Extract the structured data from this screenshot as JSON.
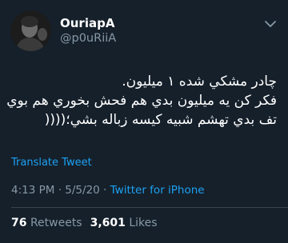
{
  "user": {
    "display_name": "OuriapA",
    "handle": "@p0uRiiA"
  },
  "tweet": {
    "lines": [
      "چادر مشکي شده ۱ ميليون.",
      "فکر کن يه ميليون بدي هم فحش بخوري هم بوي",
      "تف بدي تهشم شبيه کيسه زباله بشي؛(((("
    ],
    "translate_label": "Translate Tweet",
    "time": "4:13 PM",
    "date": "5/5/20",
    "separator": "·",
    "source": "Twitter for iPhone"
  },
  "stats": {
    "retweets_count": "76",
    "retweets_label": "Retweets",
    "likes_count": "3,601",
    "likes_label": "Likes"
  },
  "colors": {
    "background": "#15202b",
    "accent": "#1da1f2",
    "secondary_text": "#8899a6",
    "divider": "#38444d"
  },
  "icons": {
    "menu": "chevron-down-icon"
  }
}
